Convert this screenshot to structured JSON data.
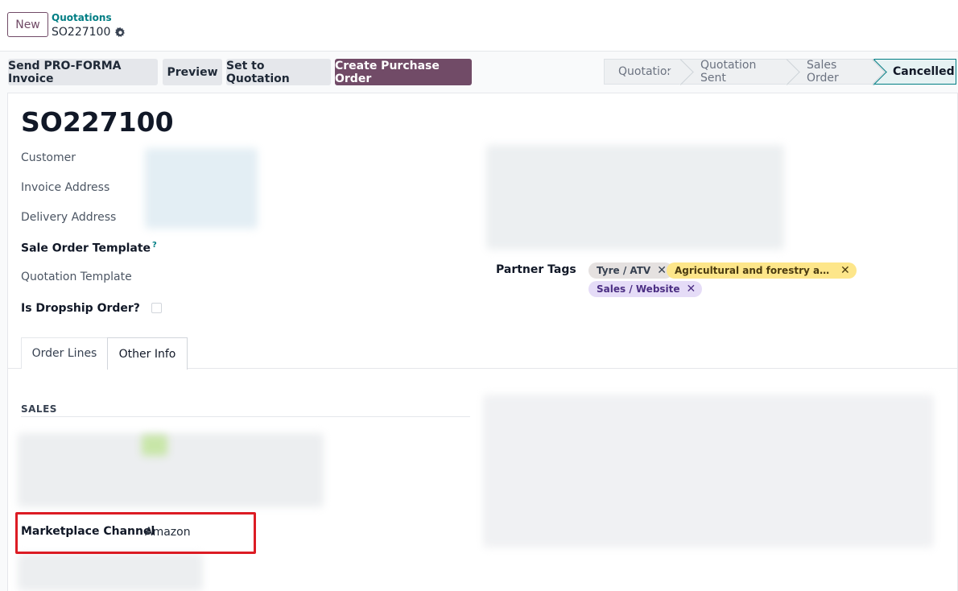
{
  "topbar": {
    "new_label": "New",
    "breadcrumb_parent": "Quotations",
    "breadcrumb_current": "SO227100"
  },
  "actions": {
    "send_proforma": "Send PRO-FORMA Invoice",
    "preview": "Preview",
    "set_to_quotation": "Set to Quotation",
    "create_purchase_order": "Create Purchase Order"
  },
  "statusbar": {
    "stages": [
      "Quotation",
      "Quotation Sent",
      "Sales Order",
      "Cancelled"
    ],
    "active": "Cancelled"
  },
  "form": {
    "title": "SO227100",
    "customer_label": "Customer",
    "invoice_address_label": "Invoice Address",
    "delivery_address_label": "Delivery Address",
    "sale_order_template_label": "Sale Order Template",
    "sale_order_template_help": "?",
    "quotation_template_label": "Quotation Template",
    "is_dropship_label": "Is Dropship Order?",
    "is_dropship_value": false,
    "partner_tags_label": "Partner Tags",
    "partner_tags": [
      {
        "label": "Tyre / ATV",
        "color": "#e5e1e0"
      },
      {
        "label": "Agricultural and forestry and land...",
        "color": "#fde68a"
      },
      {
        "label": "Sales / Website",
        "color": "#e5dcf7"
      }
    ]
  },
  "tabs": {
    "order_lines": "Order Lines",
    "other_info": "Other Info",
    "active": "Other Info"
  },
  "other_info": {
    "sales_section": "SALES",
    "marketplace_channel_label": "Marketplace Channel",
    "marketplace_channel_value": "Amazon"
  },
  "colors": {
    "brand": "#714b67",
    "accent": "#017e84",
    "highlight": "#dc1c24"
  }
}
